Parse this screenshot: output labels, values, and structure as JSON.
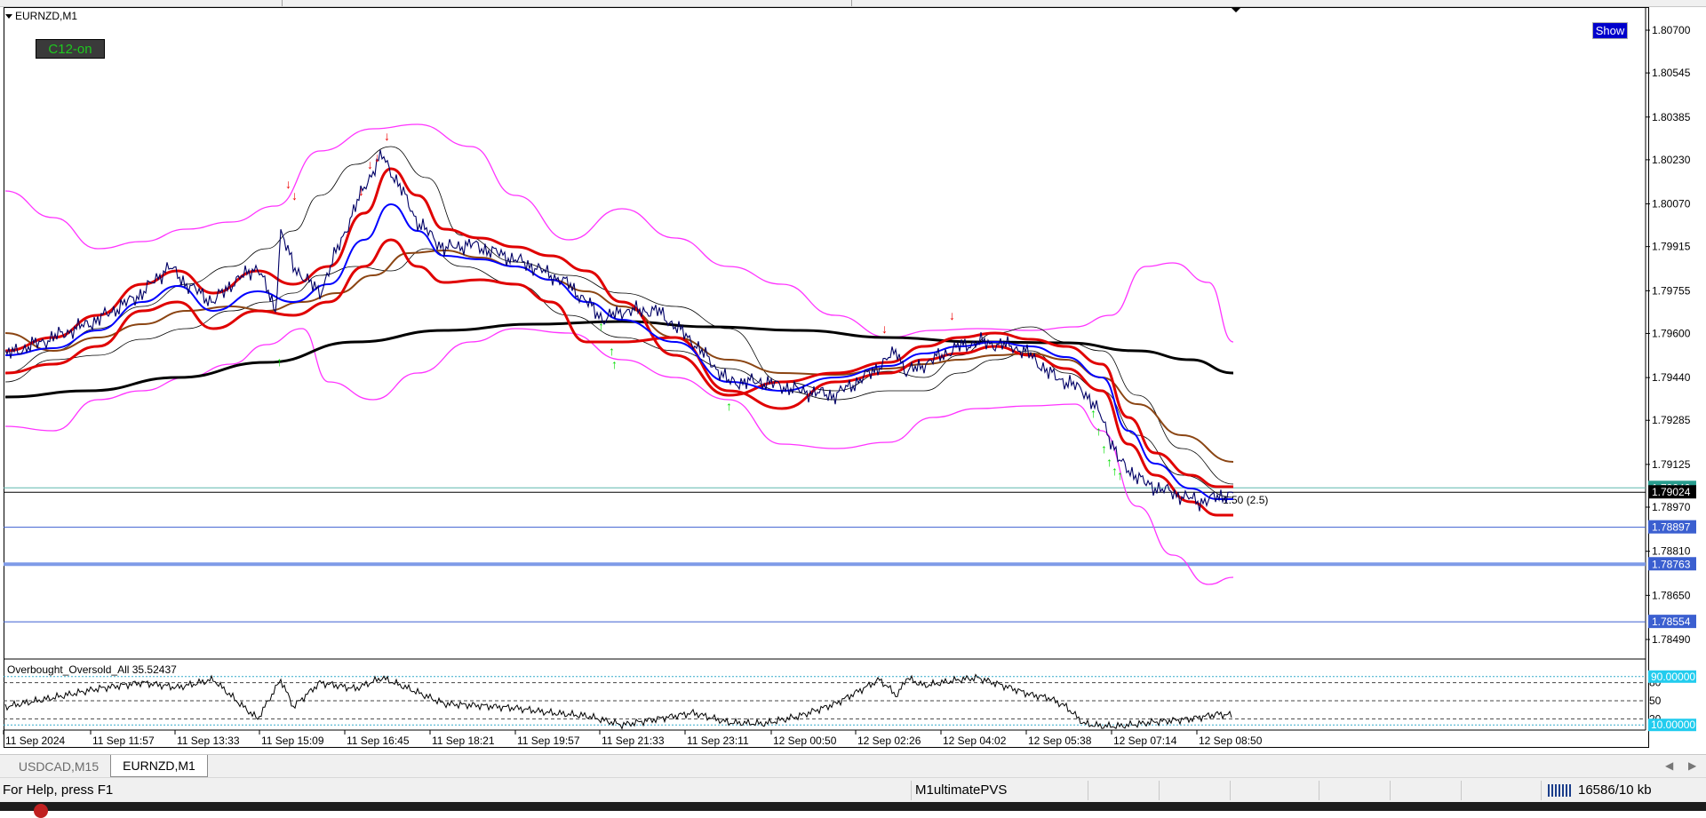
{
  "chart": {
    "symbol": "EURNZD,M1",
    "c12_label": "C12-on",
    "show_label": "Show",
    "price_ticks": [
      "1.80700",
      "1.80545",
      "1.80385",
      "1.80230",
      "1.80070",
      "1.79915",
      "1.79755",
      "1.79600",
      "1.79440",
      "1.79285",
      "1.79125",
      "1.78970",
      "1.78810",
      "1.78650",
      "1.78490"
    ],
    "price_badges": [
      "1.79040",
      "1.79024",
      "1.78897",
      "1.78763",
      "1.78554"
    ],
    "price_badge_colors": [
      "#2a9d8f",
      "#000000",
      "#3b5fd0",
      "#3b5fd0",
      "#3b5fd0"
    ],
    "trade_label": "1.50 (2.5)",
    "time_ticks": [
      "11 Sep 2024",
      "11 Sep 11:57",
      "11 Sep 13:33",
      "11 Sep 15:09",
      "11 Sep 16:45",
      "11 Sep 18:21",
      "11 Sep 19:57",
      "11 Sep 21:33",
      "11 Sep 23:11",
      "12 Sep 00:50",
      "12 Sep 02:26",
      "12 Sep 04:02",
      "12 Sep 05:38",
      "12 Sep 07:14",
      "12 Sep 08:50"
    ]
  },
  "oscillator": {
    "label": "Overbought_Oversold_All 35.52437",
    "levels": [
      "80",
      "50",
      "20"
    ],
    "badges": [
      "90.00000",
      "10.00000"
    ]
  },
  "tabs": [
    "USDCAD,M15",
    "EURNZD,M1"
  ],
  "status": {
    "help": "For Help, press F1",
    "profile": "M1ultimatePVS",
    "traffic": "16586/10 kb"
  },
  "colors": {
    "price": "#000066",
    "upper_envelope": "#ff33ff",
    "ma_red": "#e00000",
    "ma_blue": "#0000ff",
    "ma_brown": "#8b4513",
    "ma_black": "#000000",
    "up_arrow": "#00dd00",
    "down_arrow": "#ee0000",
    "badge_bg": "#3b5fd0"
  }
}
